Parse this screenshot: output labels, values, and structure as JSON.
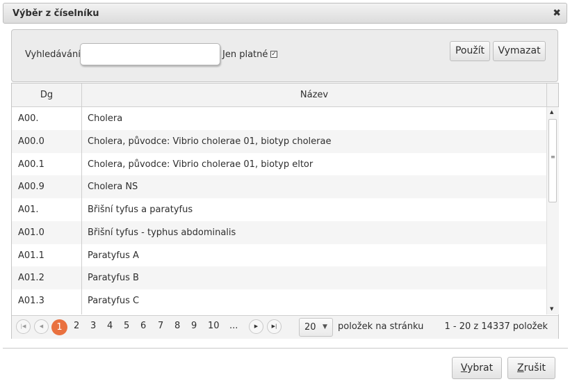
{
  "dialog": {
    "title": "Výběr z číselníku",
    "close_glyph": "✖"
  },
  "filter": {
    "search_label": "Vyhledávání",
    "search_value": "",
    "valid_only_label": "Jen platné",
    "valid_only_checked": true,
    "apply_label": "Použít",
    "clear_label": "Vymazat"
  },
  "grid": {
    "columns": [
      "Dg",
      "Název"
    ],
    "rows": [
      {
        "code": "A00.",
        "name": "Cholera"
      },
      {
        "code": "A00.0",
        "name": "Cholera, původce: Vibrio cholerae 01, biotyp cholerae"
      },
      {
        "code": "A00.1",
        "name": "Cholera, původce: Vibrio cholerae 01, biotyp eltor"
      },
      {
        "code": "A00.9",
        "name": "Cholera NS"
      },
      {
        "code": "A01.",
        "name": "Břišní tyfus a paratyfus"
      },
      {
        "code": "A01.0",
        "name": "Břišní tyfus - typhus abdominalis"
      },
      {
        "code": "A01.1",
        "name": "Paratyfus A"
      },
      {
        "code": "A01.2",
        "name": "Paratyfus B"
      },
      {
        "code": "A01.3",
        "name": "Paratyfus C"
      }
    ]
  },
  "pager": {
    "pages": [
      "1",
      "2",
      "3",
      "4",
      "5",
      "6",
      "7",
      "8",
      "9",
      "10",
      "..."
    ],
    "current_page": "1",
    "page_size": "20",
    "per_page_label": "položek na stránku",
    "info": "1 - 20 z 14337 položek",
    "accent_color": "#e9713f"
  },
  "footer": {
    "select_first": "V",
    "select_rest": "ybrat",
    "cancel_first": "Z",
    "cancel_rest": "rušit"
  }
}
